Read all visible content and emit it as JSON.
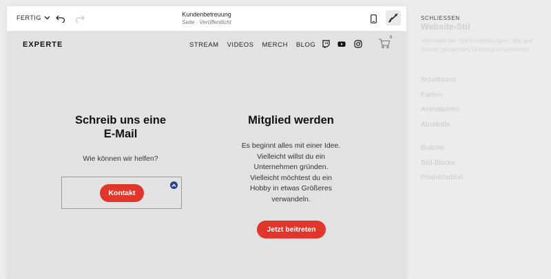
{
  "toolbar": {
    "done_label": "FERTIG",
    "page_title": "Kundenbetreuung",
    "page_status": "Seite · Veröffentlicht"
  },
  "site": {
    "logo": "EXPERTE",
    "nav": [
      "STREAM",
      "VIDEOS",
      "MERCH",
      "BLOG"
    ],
    "cart_count": "0"
  },
  "contact": {
    "title_line1": "Schreib uns eine",
    "title_line2": "E-Mail",
    "text": "Wie können wir helfen?",
    "button": "Kontakt"
  },
  "member": {
    "title": "Mitglied werden",
    "text_lines": [
      "Es beginnt alles mit einer Idee.",
      "Vielleicht willst du ein",
      "Unternehmen gründen.",
      "Vielleicht möchtest du ein",
      "Hobby in etwas Größeres",
      "verwandeln."
    ],
    "button": "Jetzt beitreten"
  },
  "panel": {
    "close_label": "SCHLIESSEN",
    "title": "Website-Stil",
    "description": "Verwalte die Stil-Einstellungen, die auf deiner gesamten Website erscheinen.",
    "group1": [
      "Schriftarten",
      "Farben",
      "Animationen",
      "Abstände"
    ],
    "group2": [
      "Buttons",
      "Bild-Blöcke",
      "Produktartikel"
    ]
  },
  "colors": {
    "accent": "#e0362c",
    "selection": "#8d96c8",
    "handle": "#2a3f8f"
  }
}
